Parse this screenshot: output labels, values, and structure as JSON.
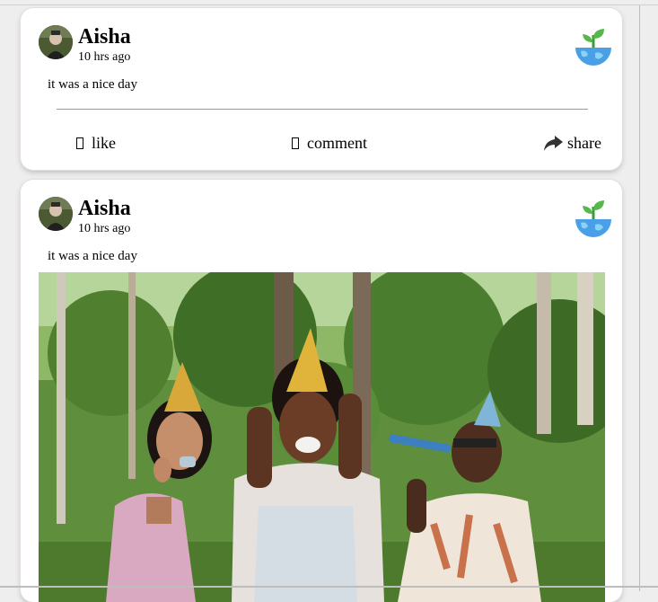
{
  "posts": [
    {
      "author": "Aisha",
      "time": "10 hrs ago",
      "text": "it was a nice day",
      "actions": {
        "like": "like",
        "comment": "comment",
        "share": "share"
      }
    },
    {
      "author": "Aisha",
      "time": "10 hrs ago",
      "text": "it was a nice day",
      "has_image": true
    }
  ],
  "icons": {
    "badge": "earth-sprout-icon",
    "like": "like-icon",
    "comment": "comment-icon",
    "share": "share-arrow-icon"
  },
  "colors": {
    "card_bg": "#ffffff",
    "page_bg": "#eeeeee",
    "card_shadow": "#d9cfcf"
  }
}
